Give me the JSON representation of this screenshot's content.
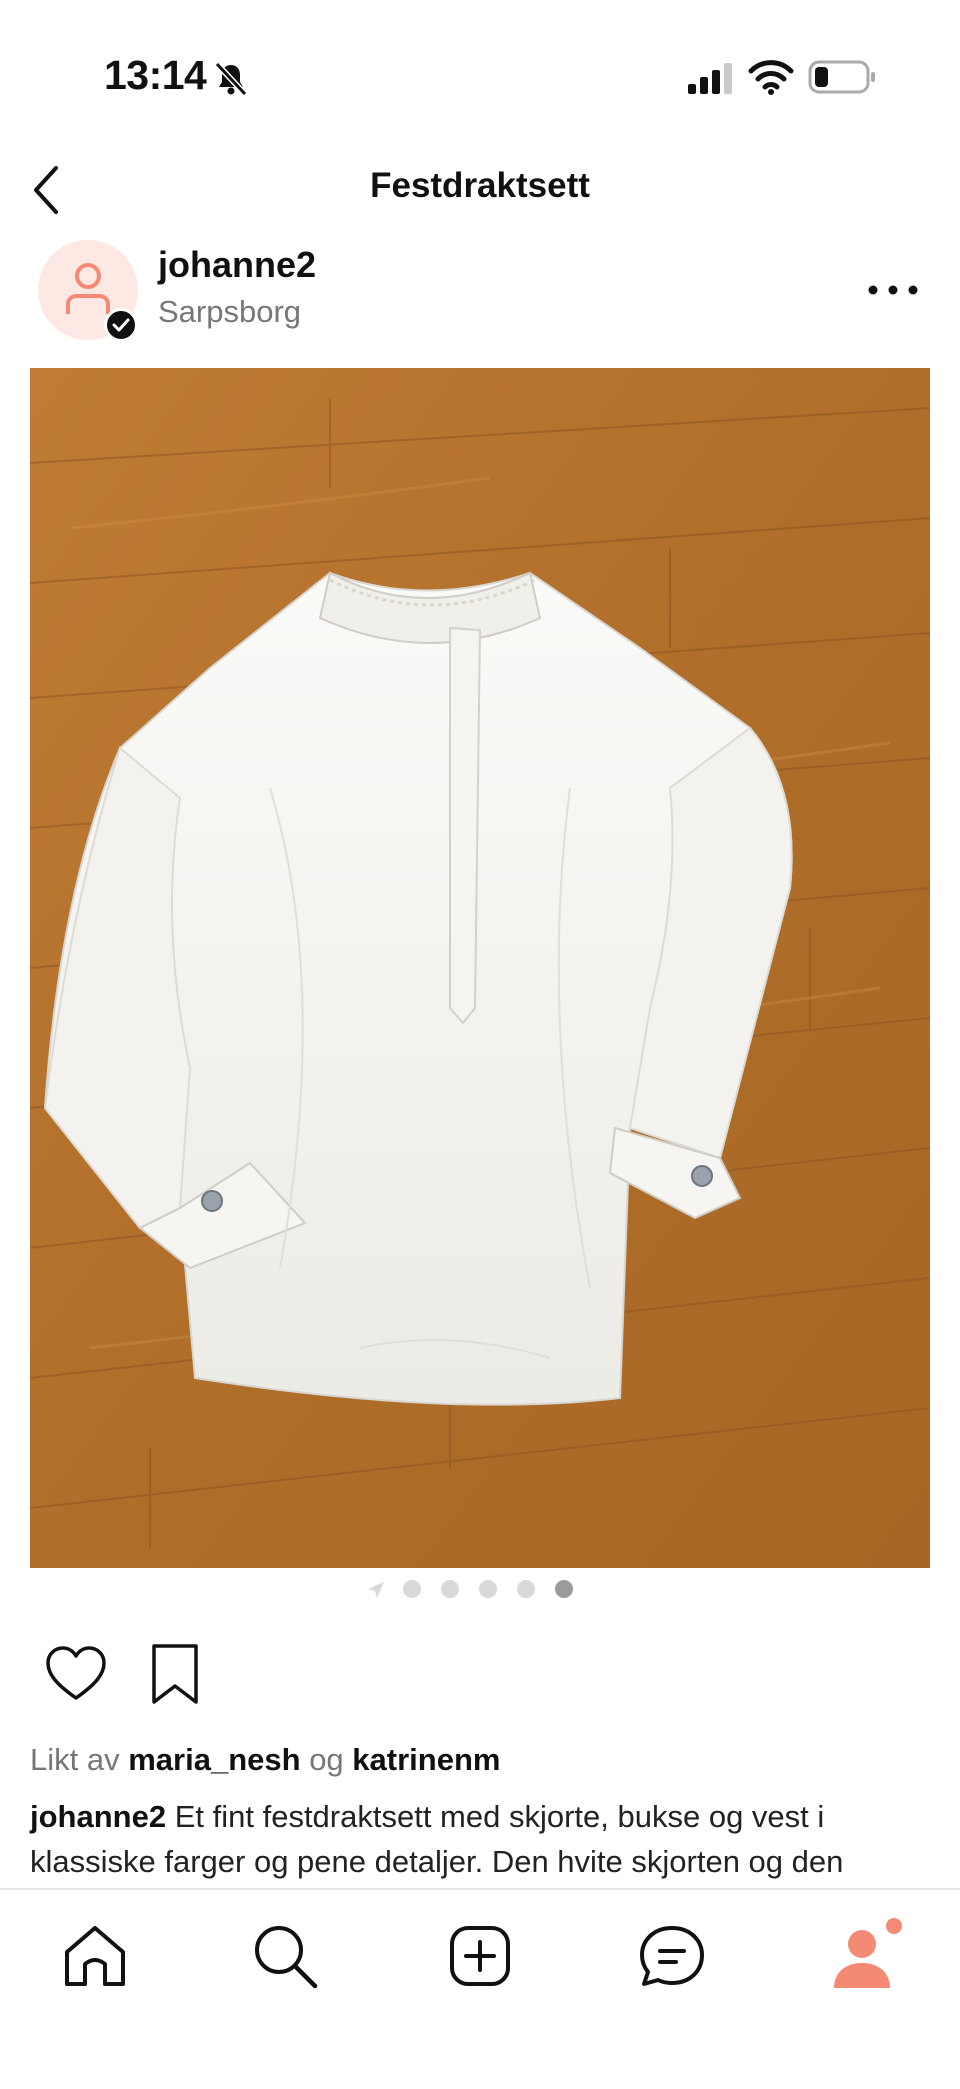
{
  "status_bar": {
    "time": "13:14",
    "icons": [
      "bell-slash-icon",
      "signal-icon",
      "wifi-icon",
      "battery-icon"
    ]
  },
  "header": {
    "title": "Festdraktsett",
    "back_icon": "chevron-left-icon"
  },
  "post": {
    "username": "johanne2",
    "location": "Sarpsborg",
    "avatar_icon": "person-icon",
    "verified_icon": "checkmark-icon",
    "more_icon": "more-dots-icon",
    "carousel": {
      "total": 5,
      "active_index": 5
    },
    "actions": [
      "heart-icon",
      "bookmark-icon"
    ],
    "likes": {
      "prefix": "Likt av",
      "user1": "maria_nesh",
      "joiner": "og",
      "user2": "katrinenm"
    },
    "caption": {
      "username": "johanne2",
      "text": "Et fint festdraktsett med skjorte, bukse og vest i klassiske farger og pene detaljer. Den hvite skjorten og den"
    }
  },
  "tab_bar": {
    "items": [
      "home-icon",
      "search-icon",
      "add-icon",
      "messages-icon",
      "profile-icon"
    ],
    "active": "profile-icon"
  },
  "colors": {
    "accent": "#f48a74",
    "avatar_bg": "#fde8e3",
    "floor": "#b7762f",
    "text": "#111111",
    "muted": "#777777"
  }
}
